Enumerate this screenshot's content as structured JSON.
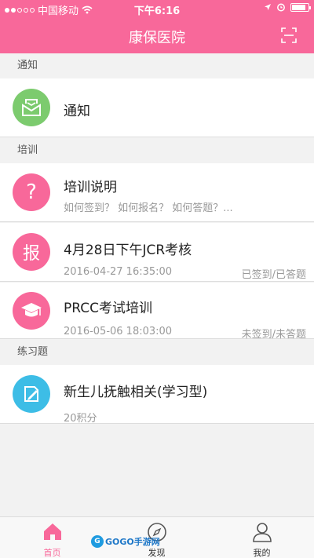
{
  "status_bar": {
    "carrier": "中国移动",
    "time": "下午6:16"
  },
  "nav": {
    "title": "康保医院",
    "scan_icon": "scan-icon"
  },
  "sections": {
    "notice": {
      "header": "通知",
      "item_title": "通知",
      "icon": "envelope-icon",
      "color": "#7ccb6e"
    },
    "training": {
      "header": "培训",
      "items": [
        {
          "title": "培训说明",
          "subtitle": "如何签到？ 如何报名？ 如何答题？...",
          "icon_text": "?",
          "color": "#f8689a"
        },
        {
          "title": "4月28日下午JCR考核",
          "date": "2016-04-27 16:35:00",
          "status": "已签到/已答题",
          "icon_text": "报",
          "color": "#f8689a"
        },
        {
          "title": "PRCC考试培训",
          "date": "2016-05-06 18:03:00",
          "status": "未签到/未答题",
          "icon": "graduation-cap-icon",
          "color": "#f8689a"
        }
      ]
    },
    "exercise": {
      "header": "练习题",
      "items": [
        {
          "title": "新生儿抚触相关(学习型)",
          "subtitle": "20积分",
          "icon": "edit-document-icon",
          "color": "#3dbde6"
        }
      ]
    }
  },
  "tabs": [
    {
      "label": "首页",
      "icon": "home-icon",
      "active": true
    },
    {
      "label": "发现",
      "icon": "compass-icon",
      "active": false
    },
    {
      "label": "我的",
      "icon": "user-icon",
      "active": false
    }
  ],
  "watermark": {
    "text": "GOGO手游网",
    "logo_text": "G"
  },
  "colors": {
    "accent": "#f8689a",
    "green": "#7ccb6e",
    "blue": "#3dbde6"
  }
}
